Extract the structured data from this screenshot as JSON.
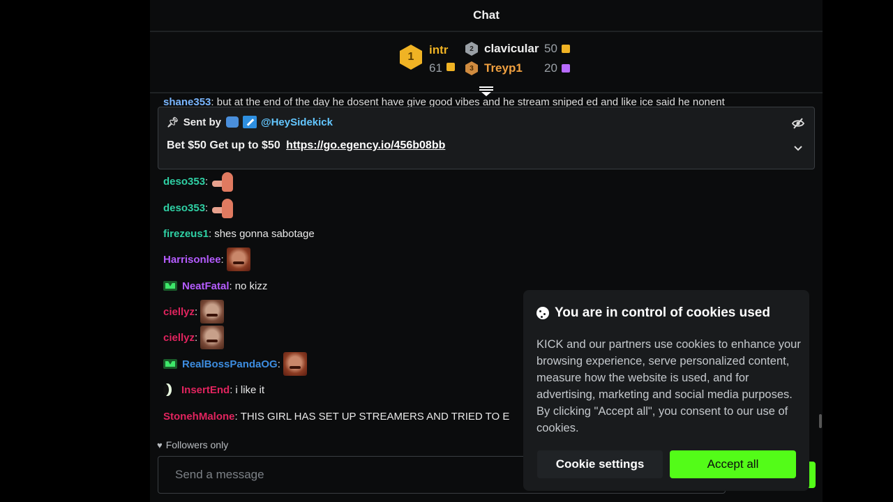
{
  "chat": {
    "title": "Chat"
  },
  "leaderboard": {
    "first": {
      "rank": "1",
      "name": "intr",
      "count": "61"
    },
    "second": {
      "rank": "2",
      "name": "clavicular",
      "count": "50"
    },
    "third": {
      "rank": "3",
      "name": "Treyp1",
      "count": "20"
    }
  },
  "cut_message": {
    "user": "shane353",
    "text": ": but at the end of the day he dosent have give good vibes and he stream sniped ed and like ice said he nonent"
  },
  "pinned": {
    "sent_by_label": "Sent by",
    "sender": "@HeySidekick",
    "message": "Bet $50 Get up to $50",
    "link": "https://go.egency.io/456b08bb"
  },
  "messages": [
    {
      "user": "deso353",
      "color": "#2fd0a4",
      "text": ""
    },
    {
      "user": "deso353",
      "color": "#2fd0a4",
      "text": ""
    },
    {
      "user": "firezeus1",
      "color": "#2fd0a4",
      "text": "shes gonna sabotage"
    },
    {
      "user": "Harrisonlee",
      "color": "#b55cff",
      "text": ""
    },
    {
      "user": "NeatFatal",
      "color": "#b55cff",
      "text": "no kizz"
    },
    {
      "user": "ciellyz",
      "color": "#e0245e",
      "text": ""
    },
    {
      "user": "ciellyz",
      "color": "#e0245e",
      "text": ""
    },
    {
      "user": "RealBossPandaOG",
      "color": "#3d8de0",
      "text": ""
    },
    {
      "user": "InsertEnd",
      "color": "#e0245e",
      "text": "i like it"
    },
    {
      "user": "StonehMalone",
      "color": "#e0245e",
      "text": "THIS GIRL HAS SET UP STREAMERS AND TRIED TO E"
    }
  ],
  "followers_only": "Followers only",
  "input": {
    "placeholder": "Send a message"
  },
  "cookie": {
    "title": "You are in control of cookies used",
    "body": "KICK and our partners use cookies to enhance your browsing experience, serve personalized content, measure how the website is used, and for advertising, marketing and social media purposes. By clicking \"Accept all\", you consent to our use of cookies.",
    "settings_label": "Cookie settings",
    "accept_label": "Accept all"
  },
  "colors": {
    "accent": "#53fc18",
    "background": "#0b0c0d",
    "panel": "#191b1d"
  },
  "icons": [
    "pin-icon",
    "eye-off-icon",
    "chevron-down-icon",
    "heart-icon",
    "cookie-icon",
    "collapse-icon"
  ]
}
